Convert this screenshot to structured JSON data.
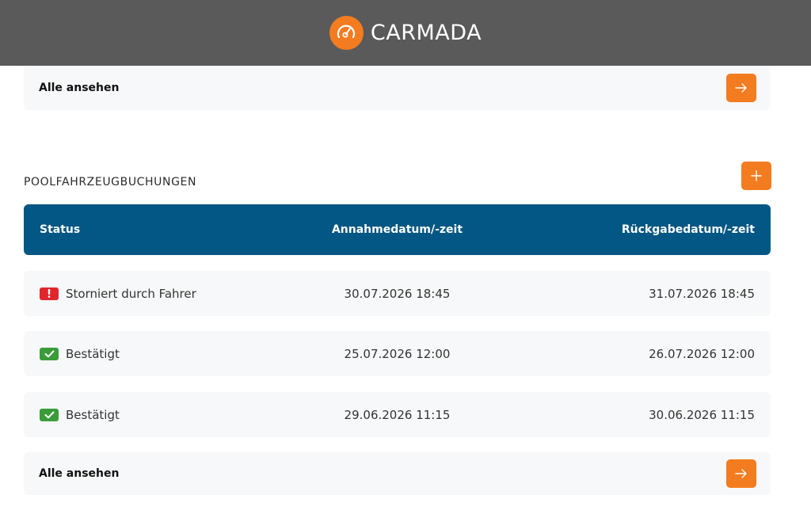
{
  "header": {
    "brand": "CARMADA",
    "logo_icon": "speedometer-icon",
    "bg": "#5a5a5a",
    "accent": "#f47c20"
  },
  "top_link": {
    "label": "Alle ansehen",
    "button_icon": "arrow-right-icon"
  },
  "section": {
    "title": "POOLFAHRZEUGBUCHUNGEN",
    "add_icon": "plus-icon"
  },
  "table": {
    "header_bg": "#035784",
    "columns": {
      "status": "Status",
      "pickup": "Annahmedatum/-zeit",
      "return": "Rückgabedatum/-zeit"
    },
    "rows": [
      {
        "status": "Storniert durch Fahrer",
        "status_icon": "exclamation-icon",
        "status_color": "#e0262d",
        "pickup": "30.07.2026 18:45",
        "return": "31.07.2026 18:45"
      },
      {
        "status": "Bestätigt",
        "status_icon": "checkmark-icon",
        "status_color": "#3a9b3a",
        "pickup": "25.07.2026 12:00",
        "return": "26.07.2026 12:00"
      },
      {
        "status": "Bestätigt",
        "status_icon": "checkmark-icon",
        "status_color": "#3a9b3a",
        "pickup": "29.06.2026 11:15",
        "return": "30.06.2026 11:15"
      }
    ]
  },
  "bottom_link": {
    "label": "Alle ansehen",
    "button_icon": "arrow-right-icon"
  }
}
